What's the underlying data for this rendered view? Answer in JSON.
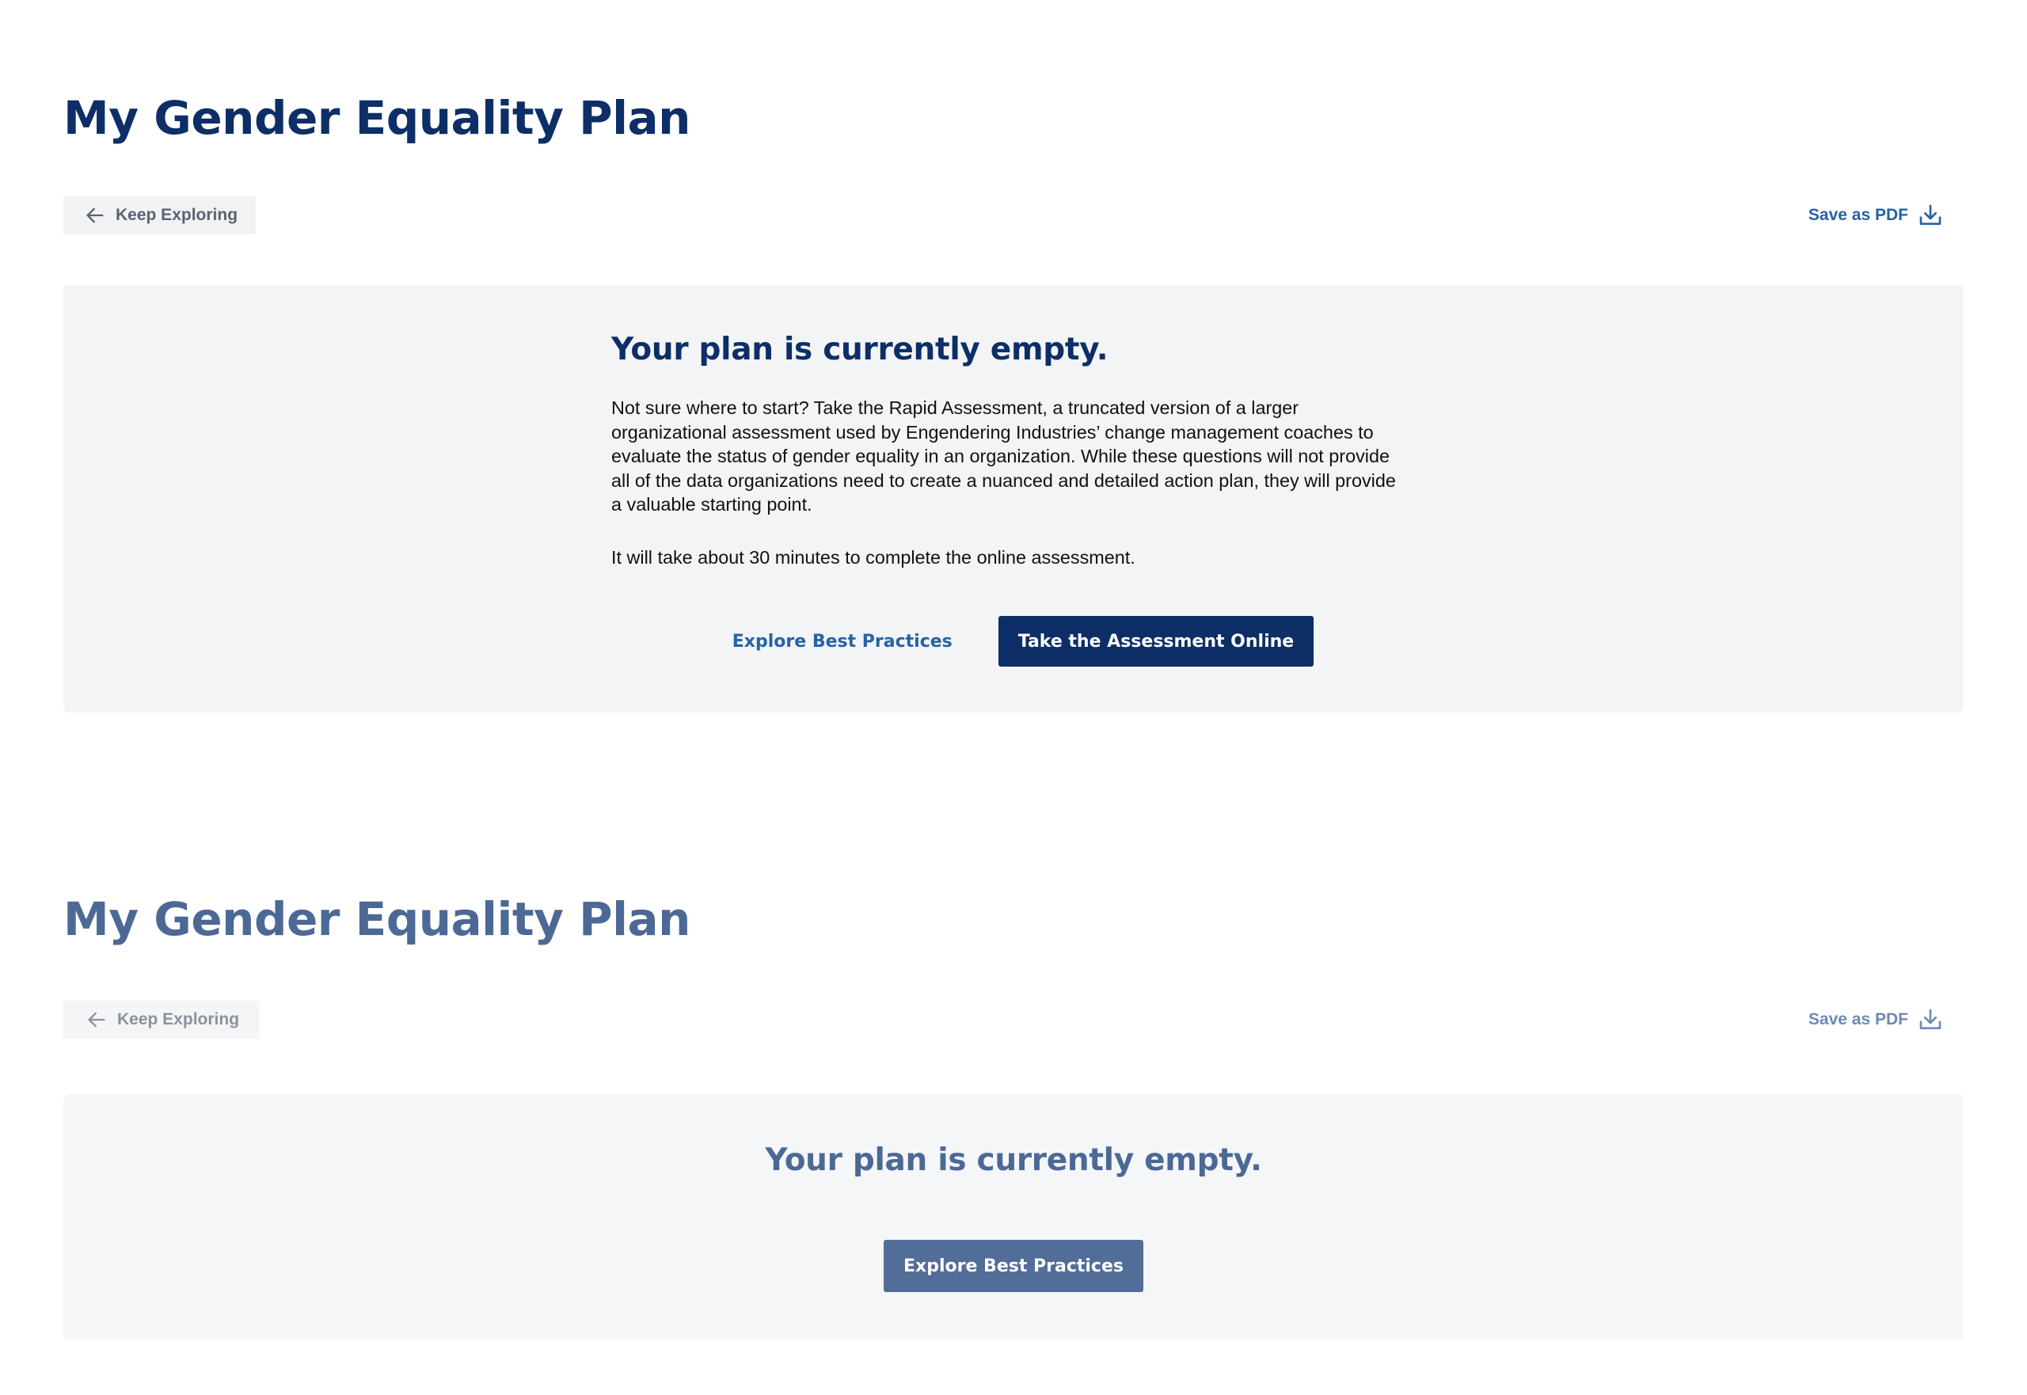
{
  "colors": {
    "navy": "#0d2e66",
    "link_blue": "#2563a4",
    "panel_bg": "#f3f4f6",
    "muted_navy": "#4c6996",
    "muted_button": "#526d98"
  },
  "sections": [
    {
      "title": "My Gender Equality Plan",
      "back_label": "Keep Exploring",
      "back_icon": "arrow-left-icon",
      "pdf_label": "Save as PDF",
      "pdf_icon": "download-icon",
      "panel": {
        "heading": "Your plan is currently empty.",
        "paragraphs": [
          "Not sure where to start? Take the Rapid Assessment, a truncated version of a larger organizational assessment used by Engendering Industries’ change management coaches to evaluate the status of gender equality in an organization. While these questions will not provide all of the data organizations need to create a nuanced and detailed action plan, they will provide a valuable starting point.",
          "It will take about 30 minutes to complete the online assessment."
        ],
        "secondary_action": "Explore Best Practices",
        "primary_action": "Take the Assessment Online"
      }
    },
    {
      "title": "My Gender Equality Plan",
      "back_label": "Keep Exploring",
      "back_icon": "arrow-left-icon",
      "pdf_label": "Save as PDF",
      "pdf_icon": "download-icon",
      "panel": {
        "heading": "Your plan is currently empty.",
        "primary_action": "Explore Best Practices"
      }
    }
  ]
}
